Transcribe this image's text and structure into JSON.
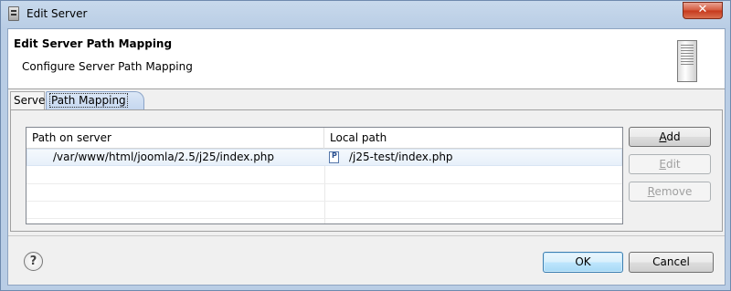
{
  "window": {
    "title": "Edit Server",
    "close_glyph": "✕"
  },
  "header": {
    "title": "Edit Server Path Mapping",
    "description": "Configure Server Path Mapping"
  },
  "tabs": [
    {
      "label": "Server"
    },
    {
      "label": "Path Mapping"
    }
  ],
  "table": {
    "columns": [
      "Path on server",
      "Local path"
    ],
    "rows": [
      {
        "server_path": "/var/www/html/joomla/2.5/j25/index.php",
        "local_path": "/j25-test/index.php"
      }
    ]
  },
  "buttons": {
    "add": {
      "accel": "A",
      "rest": "dd"
    },
    "edit": {
      "accel": "E",
      "rest": "dit"
    },
    "remove": {
      "accel": "R",
      "rest": "emove"
    },
    "ok": "OK",
    "cancel": "Cancel",
    "help": "?"
  }
}
